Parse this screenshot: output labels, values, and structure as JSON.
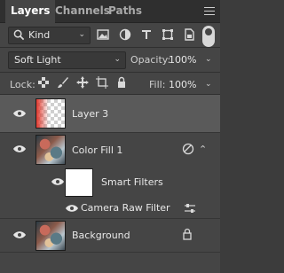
{
  "tabs": {
    "layers": "Layers",
    "channels": "Channels",
    "paths": "Paths"
  },
  "filter": {
    "kind_label": "Kind"
  },
  "blend": {
    "mode": "Soft Light",
    "opacity_label": "Opacity:",
    "opacity_value": "100%"
  },
  "lock": {
    "label": "Lock:",
    "fill_label": "Fill:",
    "fill_value": "100%"
  },
  "layers": [
    {
      "name": "Layer 3"
    },
    {
      "name": "Color Fill 1"
    },
    {
      "name": "Smart Filters"
    },
    {
      "name": "Camera Raw Filter"
    },
    {
      "name": "Background"
    }
  ],
  "colors": {
    "panel_bg": "#454545",
    "selected_row": "#5a5a5a",
    "red_gradient": "#e04b3b"
  }
}
